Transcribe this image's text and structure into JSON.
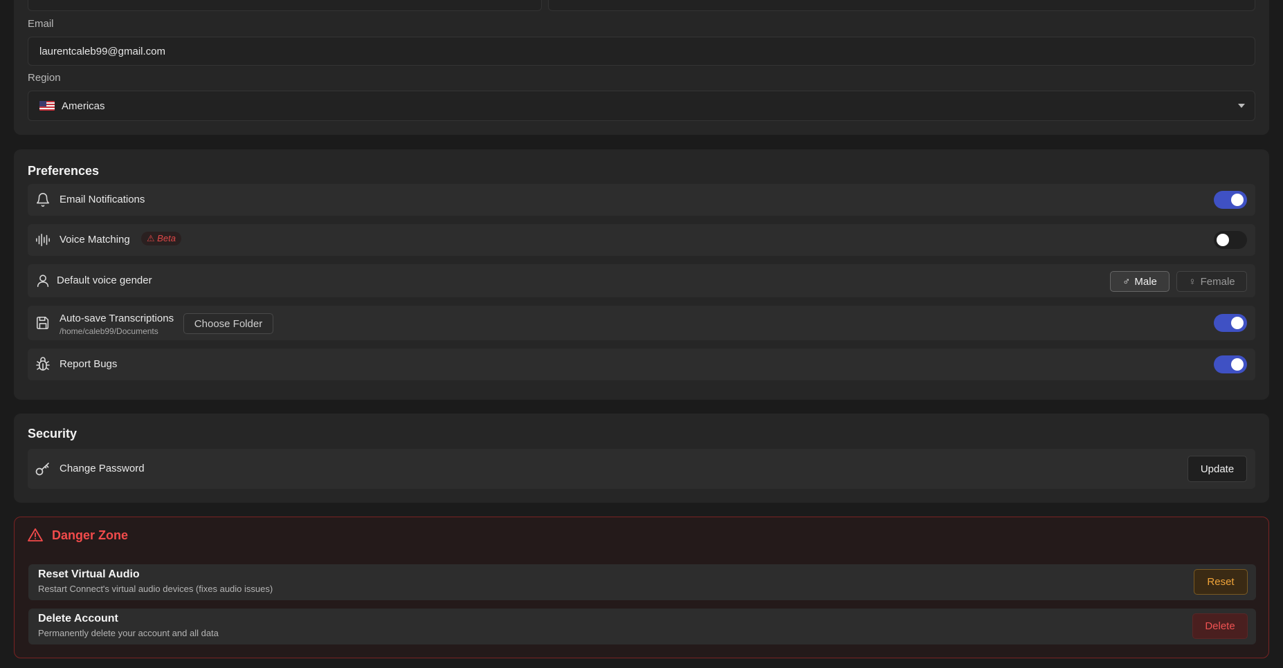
{
  "account": {
    "email_label": "Email",
    "email_value": "laurentcaleb99@gmail.com",
    "region_label": "Region",
    "region_value": "Americas"
  },
  "preferences": {
    "title": "Preferences",
    "email_notifications": {
      "label": "Email Notifications",
      "enabled": true
    },
    "voice_matching": {
      "label": "Voice Matching",
      "badge": "⚠ Beta",
      "enabled": false
    },
    "default_voice_gender": {
      "label": "Default voice gender",
      "options": [
        {
          "label": "Male",
          "symbol": "♂",
          "selected": true
        },
        {
          "label": "Female",
          "symbol": "♀",
          "selected": false
        }
      ]
    },
    "auto_save": {
      "label": "Auto-save Transcriptions",
      "path": "/home/caleb99/Documents",
      "button": "Choose Folder",
      "enabled": true
    },
    "report_bugs": {
      "label": "Report Bugs",
      "enabled": true
    }
  },
  "security": {
    "title": "Security",
    "change_password": {
      "label": "Change Password",
      "button": "Update"
    }
  },
  "danger_zone": {
    "title": "Danger Zone",
    "reset_audio": {
      "title": "Reset Virtual Audio",
      "description": "Restart Connect's virtual audio devices (fixes audio issues)",
      "button": "Reset"
    },
    "delete_account": {
      "title": "Delete Account",
      "description": "Permanently delete your account and all data",
      "button": "Delete"
    }
  },
  "colors": {
    "accent": "#3f51c4",
    "danger": "#f24b4b",
    "warning": "#f0a43a"
  }
}
